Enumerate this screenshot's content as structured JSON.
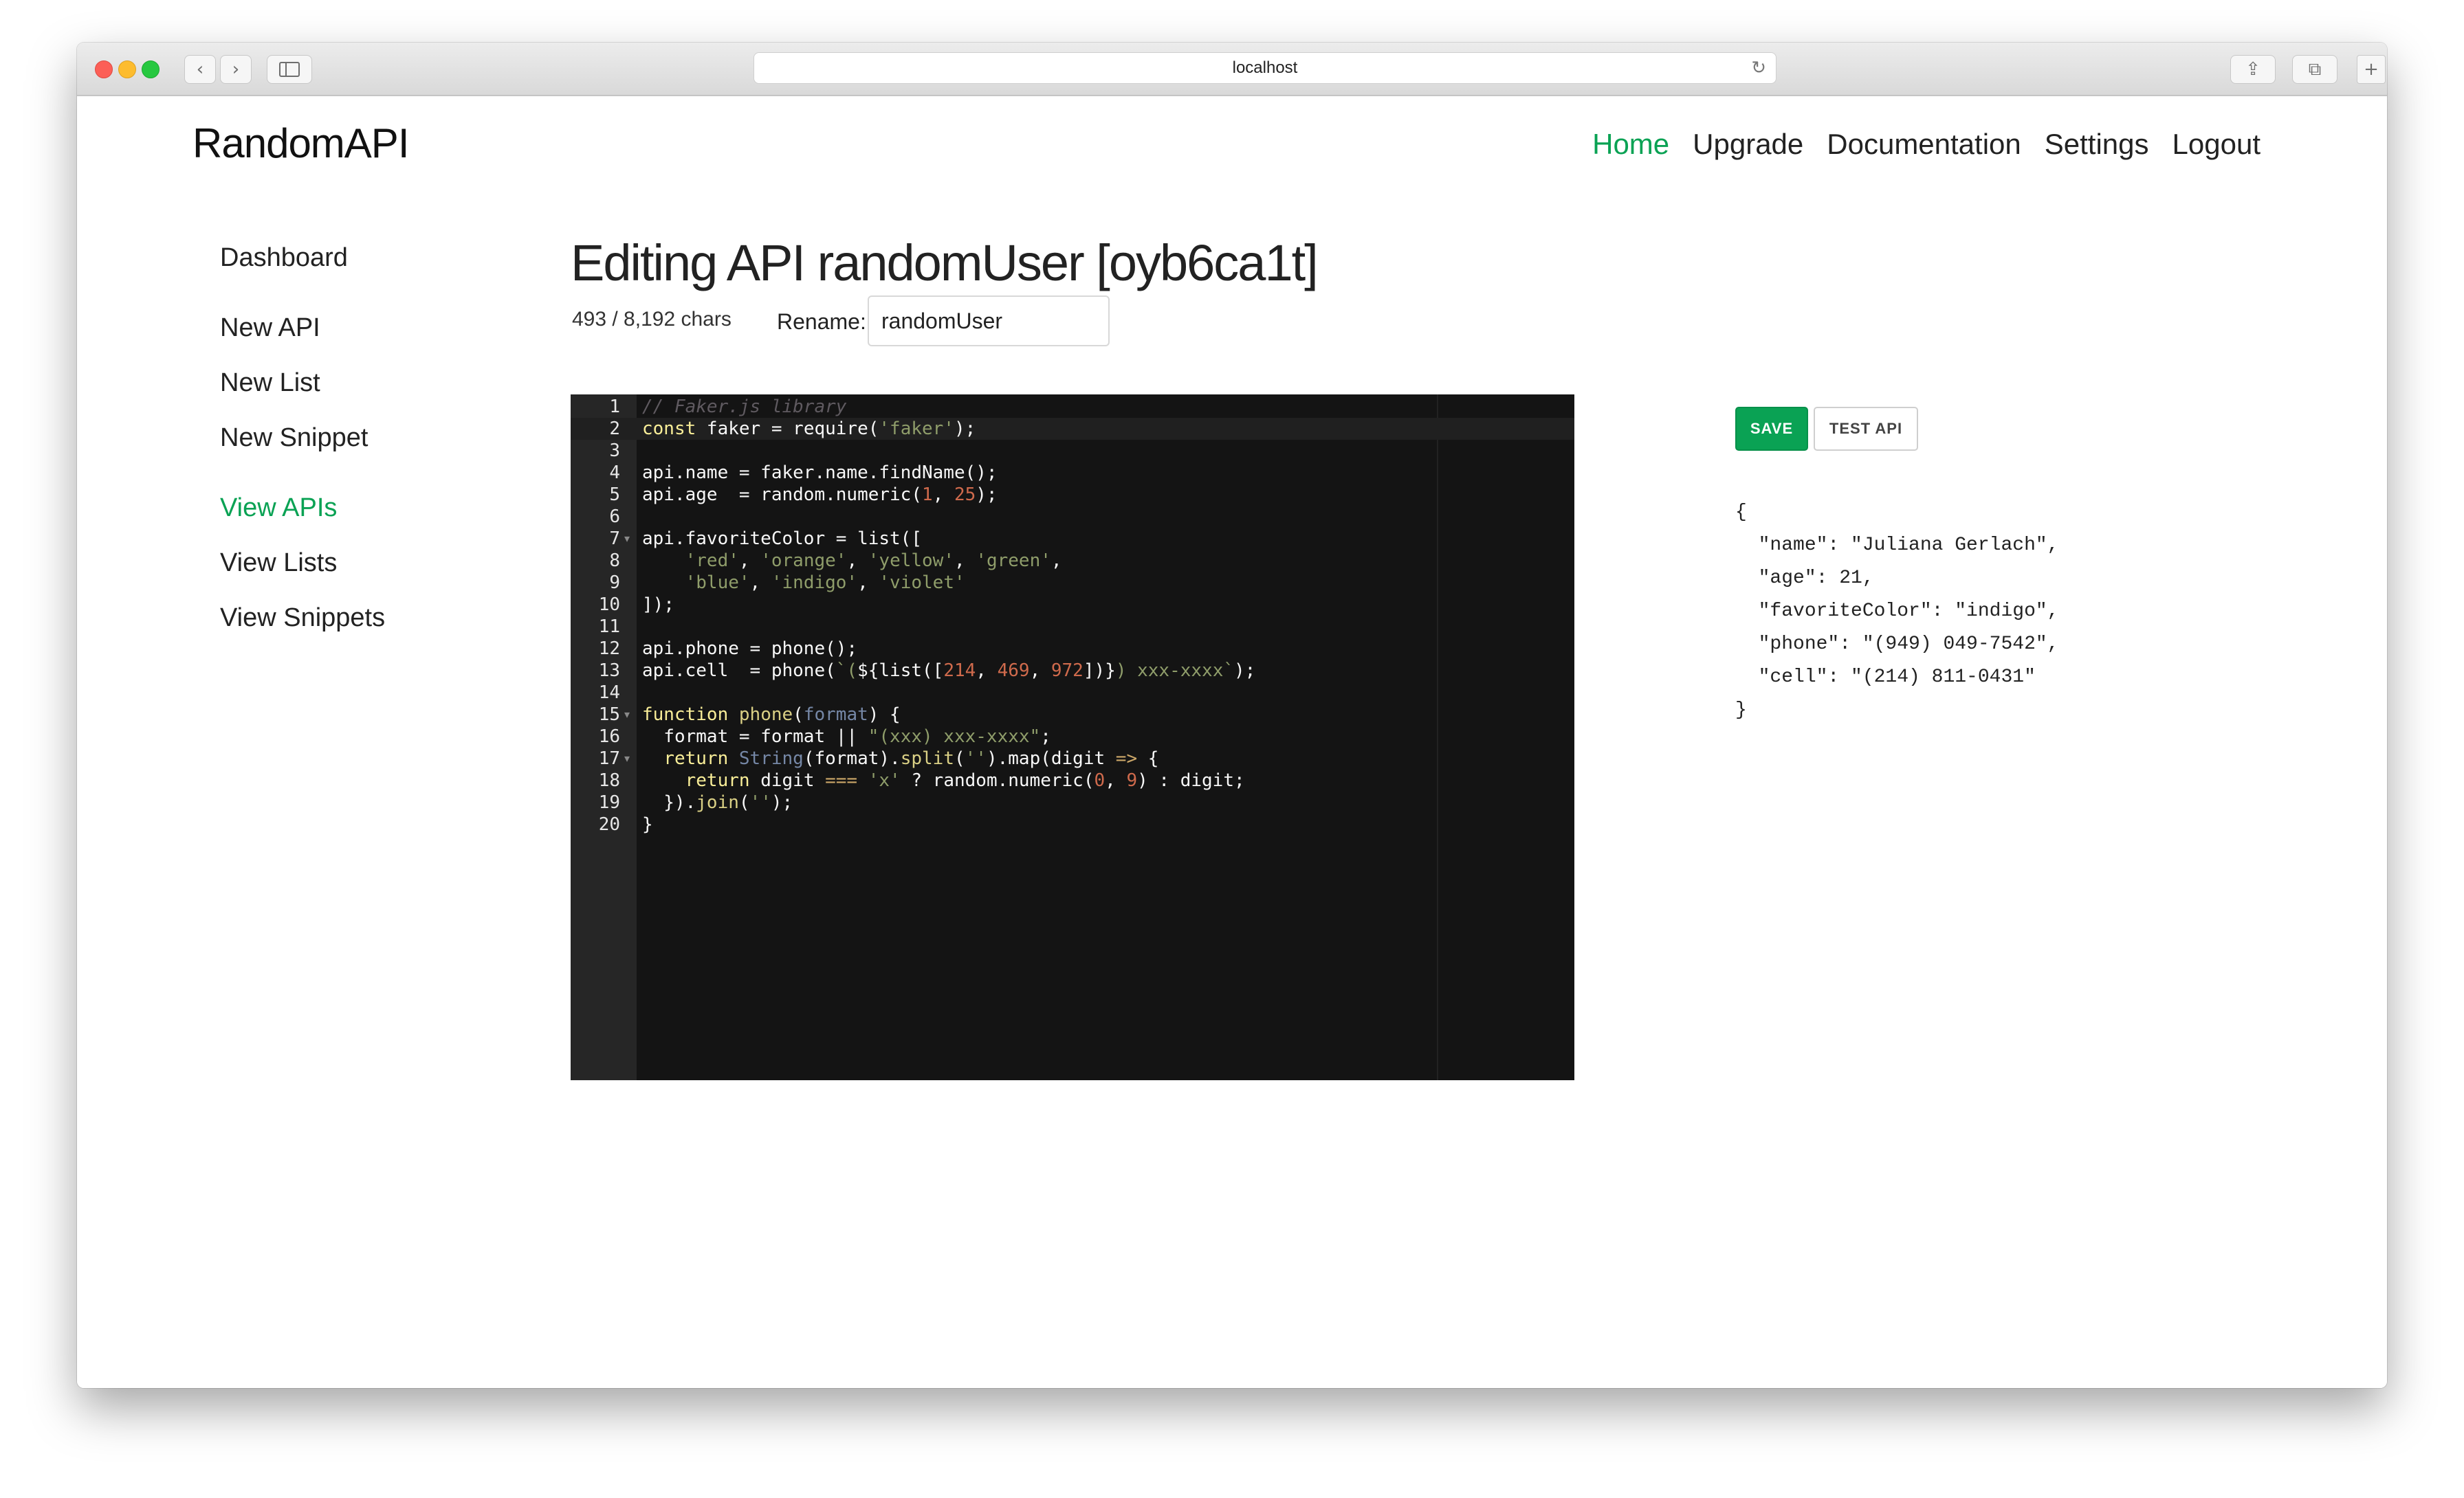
{
  "browser": {
    "url": "localhost",
    "back_icon": "chevron-left-icon",
    "forward_icon": "chevron-right-icon",
    "sidebar_icon": "sidebar-icon",
    "reload_icon": "reload-icon",
    "share_icon": "share-icon",
    "tabs_icon": "tabs-icon",
    "new_tab_icon": "plus-icon"
  },
  "brand": "RandomAPI",
  "nav": {
    "items": [
      {
        "label": "Home",
        "active": true
      },
      {
        "label": "Upgrade",
        "active": false
      },
      {
        "label": "Documentation",
        "active": false
      },
      {
        "label": "Settings",
        "active": false
      },
      {
        "label": "Logout",
        "active": false
      }
    ]
  },
  "sidebar": {
    "items": [
      {
        "label": "Dashboard",
        "active": false
      },
      {
        "label": "New API",
        "active": false
      },
      {
        "label": "New List",
        "active": false
      },
      {
        "label": "New Snippet",
        "active": false
      },
      {
        "label": "View APIs",
        "active": true
      },
      {
        "label": "View Lists",
        "active": false
      },
      {
        "label": "View Snippets",
        "active": false
      }
    ]
  },
  "editor_page": {
    "title": "Editing API randomUser [oyb6ca1t]",
    "char_count": "493 / 8,192 chars",
    "rename_label": "Rename:",
    "rename_value": "randomUser",
    "save_label": "SAVE",
    "test_label": "TEST API"
  },
  "code": {
    "active_line": 2,
    "fold_lines": [
      7,
      15,
      17
    ],
    "lines": [
      [
        [
          "comment",
          "// Faker.js library"
        ]
      ],
      [
        [
          "keyword",
          "const"
        ],
        [
          "punct",
          " faker = require("
        ],
        [
          "string",
          "'faker'"
        ],
        [
          "punct",
          ");"
        ]
      ],
      [],
      [
        [
          "punct",
          "api.name = faker.name.findName();"
        ]
      ],
      [
        [
          "punct",
          "api.age  = random.numeric("
        ],
        [
          "number",
          "1"
        ],
        [
          "punct",
          ", "
        ],
        [
          "number",
          "25"
        ],
        [
          "punct",
          ");"
        ]
      ],
      [],
      [
        [
          "punct",
          "api.favoriteColor = list(["
        ]
      ],
      [
        [
          "punct",
          "    "
        ],
        [
          "string",
          "'red'"
        ],
        [
          "punct",
          ", "
        ],
        [
          "string",
          "'orange'"
        ],
        [
          "punct",
          ", "
        ],
        [
          "string",
          "'yellow'"
        ],
        [
          "punct",
          ", "
        ],
        [
          "string",
          "'green'"
        ],
        [
          "punct",
          ","
        ]
      ],
      [
        [
          "punct",
          "    "
        ],
        [
          "string",
          "'blue'"
        ],
        [
          "punct",
          ", "
        ],
        [
          "string",
          "'indigo'"
        ],
        [
          "punct",
          ", "
        ],
        [
          "string",
          "'violet'"
        ]
      ],
      [
        [
          "punct",
          "]);"
        ]
      ],
      [],
      [
        [
          "punct",
          "api.phone = phone();"
        ]
      ],
      [
        [
          "punct",
          "api.cell  = phone("
        ],
        [
          "string",
          "`("
        ],
        [
          "punct",
          "${list(["
        ],
        [
          "number",
          "214"
        ],
        [
          "punct",
          ", "
        ],
        [
          "number",
          "469"
        ],
        [
          "punct",
          ", "
        ],
        [
          "number",
          "972"
        ],
        [
          "punct",
          "])}"
        ],
        [
          "string",
          ") xxx-xxxx`"
        ],
        [
          "punct",
          ");"
        ]
      ],
      [],
      [
        [
          "keyword",
          "function"
        ],
        [
          "punct",
          " "
        ],
        [
          "func",
          "phone"
        ],
        [
          "punct",
          "("
        ],
        [
          "param",
          "format"
        ],
        [
          "punct",
          ") {"
        ]
      ],
      [
        [
          "punct",
          "  format = format || "
        ],
        [
          "string",
          "\"(xxx) xxx-xxxx\""
        ],
        [
          "punct",
          ";"
        ]
      ],
      [
        [
          "punct",
          "  "
        ],
        [
          "keyword",
          "return"
        ],
        [
          "punct",
          " "
        ],
        [
          "param",
          "String"
        ],
        [
          "punct",
          "(format)."
        ],
        [
          "func",
          "split"
        ],
        [
          "punct",
          "("
        ],
        [
          "string",
          "''"
        ],
        [
          "punct",
          ").map(digit "
        ],
        [
          "op",
          "=>"
        ],
        [
          "punct",
          " {"
        ]
      ],
      [
        [
          "punct",
          "    "
        ],
        [
          "keyword",
          "return"
        ],
        [
          "punct",
          " digit "
        ],
        [
          "op",
          "==="
        ],
        [
          "punct",
          " "
        ],
        [
          "string",
          "'x'"
        ],
        [
          "punct",
          " ? random.numeric("
        ],
        [
          "number",
          "0"
        ],
        [
          "punct",
          ", "
        ],
        [
          "number",
          "9"
        ],
        [
          "punct",
          ") : digit;"
        ]
      ],
      [
        [
          "punct",
          "  })."
        ],
        [
          "func",
          "join"
        ],
        [
          "punct",
          "("
        ],
        [
          "string",
          "''"
        ],
        [
          "punct",
          ");"
        ]
      ],
      [
        [
          "punct",
          "}"
        ]
      ]
    ]
  },
  "result": {
    "lines": [
      "{",
      "  \"name\": \"Juliana Gerlach\",",
      "  \"age\": 21,",
      "  \"favoriteColor\": \"indigo\",",
      "  \"phone\": \"(949) 049-7542\",",
      "  \"cell\": \"(214) 811-0431\"",
      "}"
    ]
  },
  "colors": {
    "accent": "#0aa254",
    "editor_bg": "#141414",
    "gutter_bg": "#262626"
  }
}
